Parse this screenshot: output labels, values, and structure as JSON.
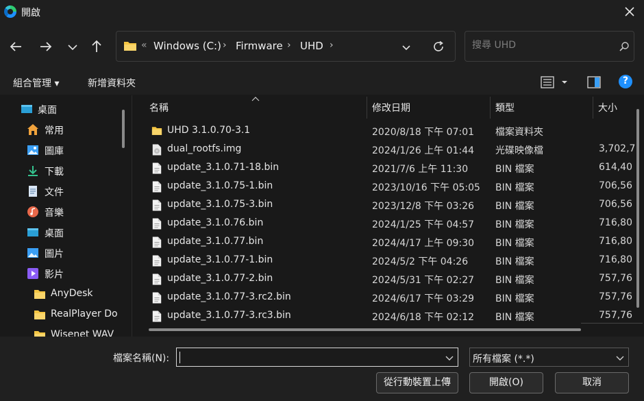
{
  "window": {
    "title": "開啟"
  },
  "address": {
    "overflow": "«",
    "crumbs": [
      "Windows (C:)",
      "Firmware",
      "UHD"
    ]
  },
  "search": {
    "placeholder": "搜尋 UHD"
  },
  "toolbar": {
    "organize": "組合管理 ▾",
    "new_folder": "新增資料夾"
  },
  "sidebar": {
    "items": [
      {
        "label": "桌面",
        "icon": "desktop-icon"
      },
      {
        "label": "常用",
        "icon": "home-icon"
      },
      {
        "label": "圖庫",
        "icon": "gallery-icon"
      },
      {
        "label": "下載",
        "icon": "download-icon"
      },
      {
        "label": "文件",
        "icon": "document-icon"
      },
      {
        "label": "音樂",
        "icon": "music-icon"
      },
      {
        "label": "桌面",
        "icon": "desktop-icon"
      },
      {
        "label": "圖片",
        "icon": "pictures-icon"
      },
      {
        "label": "影片",
        "icon": "video-icon"
      },
      {
        "label": "AnyDesk",
        "icon": "folder-icon"
      },
      {
        "label": "RealPlayer Do",
        "icon": "folder-icon"
      },
      {
        "label": "Wisenet WAV",
        "icon": "folder-icon"
      }
    ]
  },
  "columns": {
    "name": "名稱",
    "modified": "修改日期",
    "type": "類型",
    "size": "大小"
  },
  "files": [
    {
      "name": "UHD 3.1.0.70-3.1",
      "modified": "2020/8/18 下午 07:01",
      "type": "檔案資料夾",
      "size": "",
      "icon": "folder-icon"
    },
    {
      "name": "dual_rootfs.img",
      "modified": "2024/1/26 上午 01:44",
      "type": "光碟映像檔",
      "size": "3,702,7",
      "icon": "disc-image-icon"
    },
    {
      "name": "update_3.1.0.71-18.bin",
      "modified": "2021/7/6 上午 11:30",
      "type": "BIN 檔案",
      "size": "614,40",
      "icon": "file-icon"
    },
    {
      "name": "update_3.1.0.75-1.bin",
      "modified": "2023/10/16 下午 05:05",
      "type": "BIN 檔案",
      "size": "706,56",
      "icon": "file-icon"
    },
    {
      "name": "update_3.1.0.75-3.bin",
      "modified": "2023/12/8 下午 03:26",
      "type": "BIN 檔案",
      "size": "706,56",
      "icon": "file-icon"
    },
    {
      "name": "update_3.1.0.76.bin",
      "modified": "2024/1/25 下午 04:57",
      "type": "BIN 檔案",
      "size": "716,80",
      "icon": "file-icon"
    },
    {
      "name": "update_3.1.0.77.bin",
      "modified": "2024/4/17 上午 09:30",
      "type": "BIN 檔案",
      "size": "716,80",
      "icon": "file-icon"
    },
    {
      "name": "update_3.1.0.77-1.bin",
      "modified": "2024/5/2 下午 04:26",
      "type": "BIN 檔案",
      "size": "716,80",
      "icon": "file-icon"
    },
    {
      "name": "update_3.1.0.77-2.bin",
      "modified": "2024/5/31 下午 02:27",
      "type": "BIN 檔案",
      "size": "757,76",
      "icon": "file-icon"
    },
    {
      "name": "update_3.1.0.77-3.rc2.bin",
      "modified": "2024/6/17 下午 03:29",
      "type": "BIN 檔案",
      "size": "757,76",
      "icon": "file-icon"
    },
    {
      "name": "update_3.1.0.77-3.rc3.bin",
      "modified": "2024/6/18 下午 02:12",
      "type": "BIN 檔案",
      "size": "757,76",
      "icon": "file-icon"
    }
  ],
  "bottom": {
    "filename_label": "檔案名稱(N):",
    "filename_value": "",
    "filter": "所有檔案 (*.*)",
    "upload_button": "從行動裝置上傳",
    "open_button": "開啟(O)",
    "cancel_button": "取消"
  },
  "colors": {
    "accent": "#0a84ff",
    "folder": "#f4c542",
    "background": "#191919"
  }
}
